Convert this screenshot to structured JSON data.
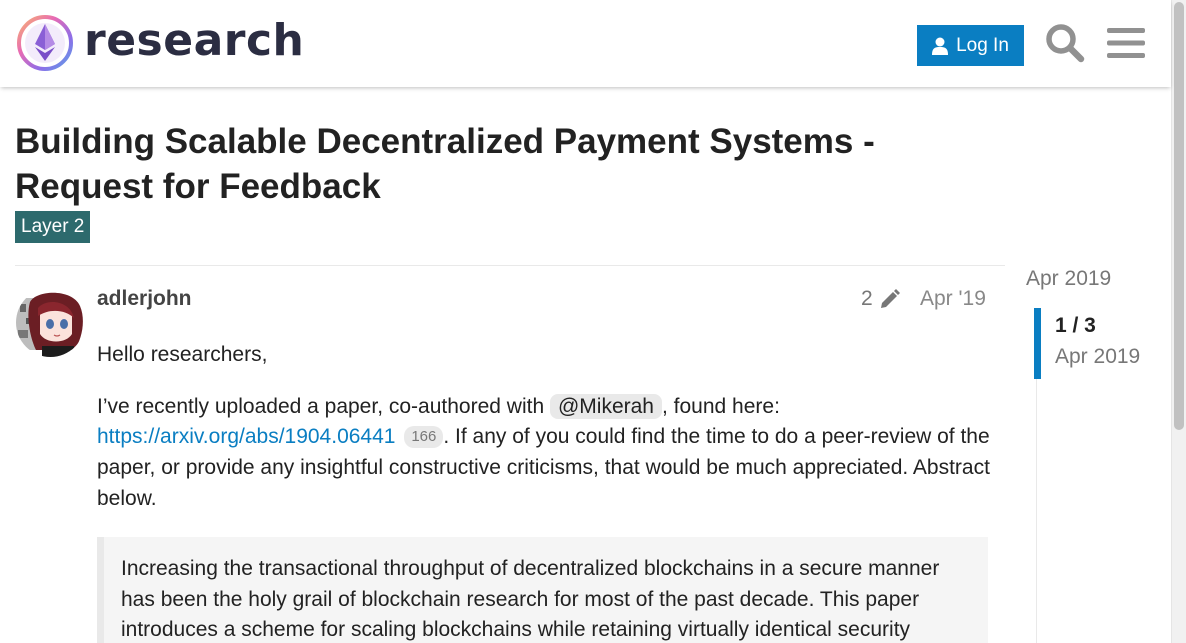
{
  "header": {
    "site_name": "research",
    "login_label": "Log In",
    "icons": [
      "logo-icon",
      "user-icon",
      "search-icon",
      "menu-icon"
    ]
  },
  "topic": {
    "title": "Building Scalable Decentralized Payment Systems - Request for Feedback",
    "category": "Layer 2",
    "category_color": "#2d6a6d"
  },
  "post": {
    "username": "adlerjohn",
    "edits": "2",
    "date": "Apr '19",
    "greeting": "Hello researchers,",
    "para2_start": "I’ve recently uploaded a paper, co-authored with ",
    "mention": "@Mikerah",
    "para2_after_mention": ", found here:",
    "link": "https://arxiv.org/abs/1904.06441",
    "link_clicks": "166",
    "para2_end": ". If any of you could find the time to do a peer-review of the paper, or provide any insightful constructive criticisms, that would be much appreciated. Abstract below.",
    "quote": "Increasing the transactional throughput of decentralized blockchains in a secure manner has been the holy grail of blockchain research for most of the past decade. This paper introduces a scheme for scaling blockchains while retaining virtually identical security"
  },
  "timeline": {
    "start_date": "Apr 2019",
    "position": "1 / 3",
    "current_date": "Apr 2019"
  },
  "colors": {
    "accent": "#0a7ec2",
    "text": "#222222",
    "muted": "#777777"
  }
}
